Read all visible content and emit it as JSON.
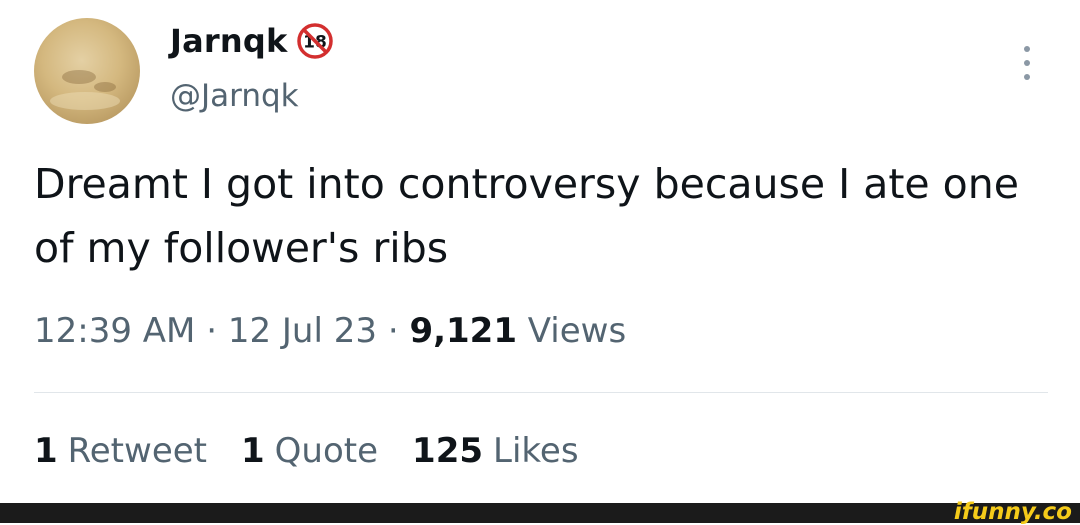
{
  "author": {
    "display_name": "Jarnqk",
    "handle": "@Jarnqk",
    "badge_icon": "no-under-18-icon",
    "badge_text": "18"
  },
  "tweet": {
    "text": "Dreamt I got into controversy because I ate one of my follower's ribs",
    "time": "12:39 AM",
    "separator": "·",
    "date": "12 Jul 23",
    "views_count": "9,121",
    "views_label": "Views"
  },
  "stats": {
    "retweets_count": "1",
    "retweets_label": "Retweet",
    "quotes_count": "1",
    "quotes_label": "Quote",
    "likes_count": "125",
    "likes_label": "Likes"
  },
  "watermark": {
    "text": "ifunny.co"
  },
  "colors": {
    "text_primary": "#0f1419",
    "text_secondary": "#536471",
    "badge_red": "#d32f2f",
    "watermark_yellow": "#f5cb1a"
  },
  "icons": {
    "more": "more-vertical-icon"
  }
}
